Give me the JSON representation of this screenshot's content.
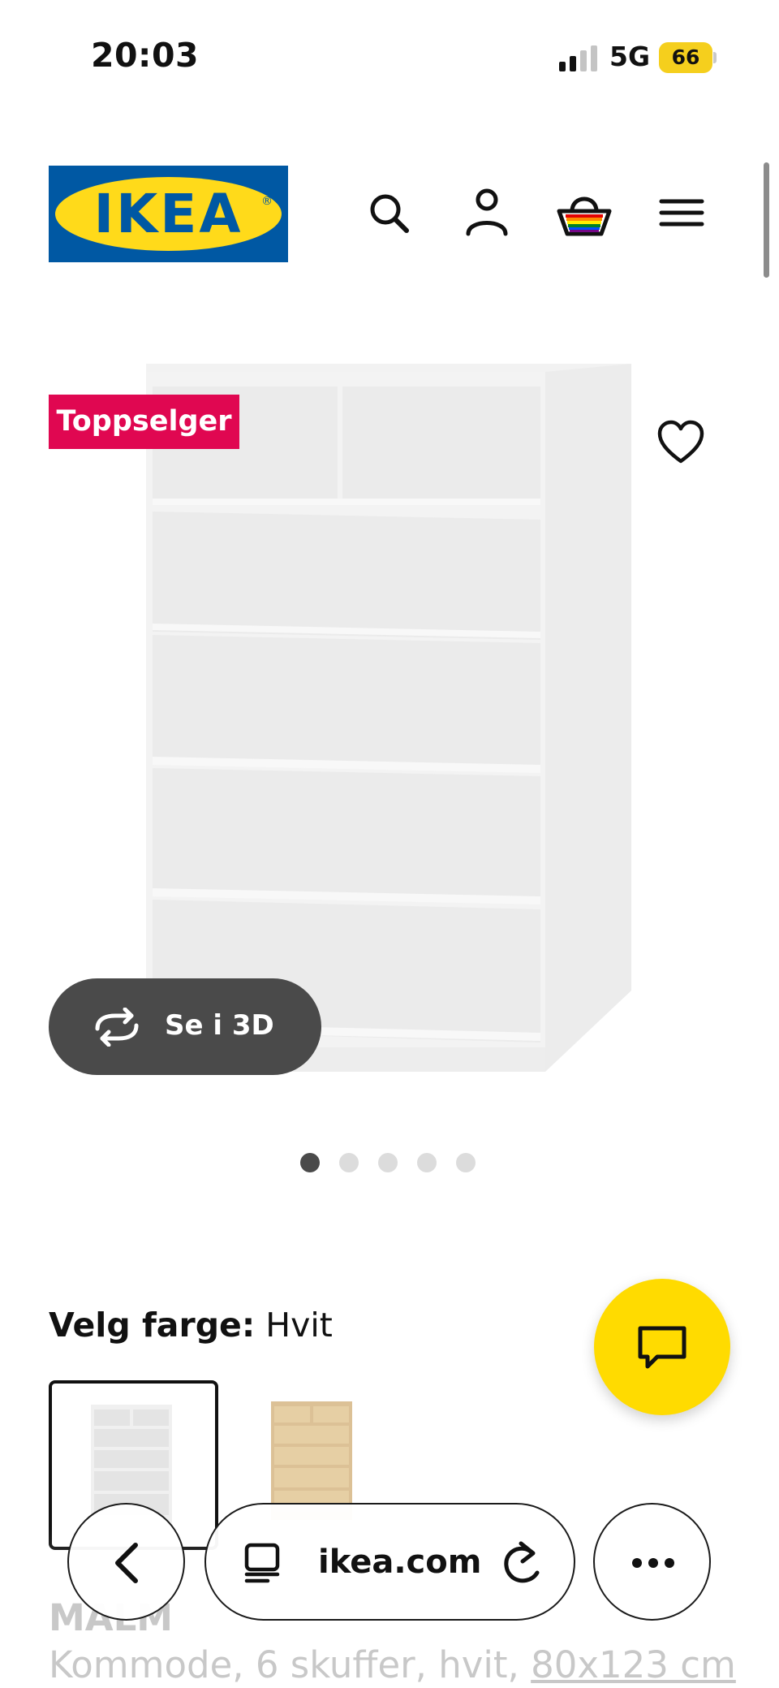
{
  "status_bar": {
    "time": "20:03",
    "network": "5G",
    "battery": "66",
    "signal_bars_active": 2,
    "signal_bars_total": 4
  },
  "header": {
    "logo_text": "IKEA",
    "logo_reg": "®",
    "icons": [
      "search-icon",
      "account-icon",
      "basket-icon",
      "menu-icon"
    ]
  },
  "gallery": {
    "badge": "Toppselger",
    "view_3d_label": "Se i 3D",
    "dot_count": 5,
    "active_dot": 0
  },
  "color_picker": {
    "label": "Velg farge:",
    "value": "Hvit",
    "options": [
      "white",
      "oak"
    ]
  },
  "product": {
    "name": "MALM",
    "description": "Kommode, 6 skuffer, hvit,",
    "size": "80x123 cm"
  },
  "browser": {
    "domain": "ikea.com"
  },
  "colors": {
    "ikea_blue": "#0058a3",
    "ikea_yellow": "#ffda1a",
    "badge_red": "#e00751",
    "chat_yellow": "#ffdb00",
    "dark_button": "#4a4a4a",
    "battery_yellow": "#f5cf1d"
  }
}
